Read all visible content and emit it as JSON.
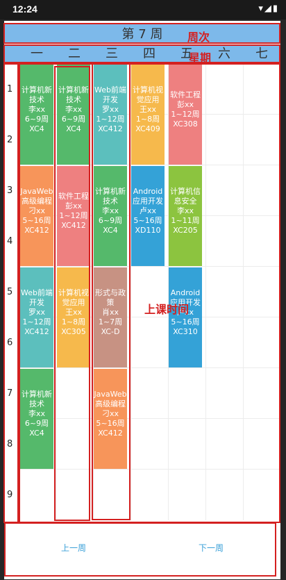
{
  "status": {
    "time": "12:24",
    "icons": "▾◢▮"
  },
  "week_title": "第 7 周",
  "days": [
    "一",
    "二",
    "三",
    "四",
    "五",
    "六",
    "七"
  ],
  "slots": [
    "1",
    "2",
    "3",
    "4",
    "5",
    "6",
    "7",
    "8",
    "9"
  ],
  "annotations": {
    "week": "周次",
    "weekday": "星期",
    "class_time": "上课时间"
  },
  "courses": [
    {
      "lines": [
        "计算机新技术",
        "李xx",
        "6~9周",
        "XC4"
      ]
    },
    {
      "lines": [
        "JavaWeb高级编程",
        "刁xx",
        "5~16周",
        "XC412"
      ]
    },
    {
      "lines": [
        "Web前端开发",
        "罗xx",
        "1~12周",
        "XC412"
      ]
    },
    {
      "lines": [
        "计算机新技术",
        "李xx",
        "6~9周",
        "XC4"
      ]
    },
    {
      "lines": [
        "计算机新技术",
        "李xx",
        "6~9周",
        "XC4"
      ]
    },
    {
      "lines": [
        "软件工程",
        "彭xx",
        "1~12周",
        "XC412"
      ]
    },
    {
      "lines": [
        "计算机视觉应用",
        "王xx",
        "1~8周",
        "XC305"
      ]
    },
    {
      "lines": [
        "Web前端开发",
        "罗xx",
        "1~12周",
        "XC412"
      ]
    },
    {
      "lines": [
        "计算机新技术",
        "李xx",
        "6~9周",
        "XC4"
      ]
    },
    {
      "lines": [
        "形式与政策",
        "肖xx",
        "1~7周",
        "XC-D"
      ]
    },
    {
      "lines": [
        "JavaWeb高级编程",
        "刁xx",
        "5~16周",
        "XC412"
      ]
    },
    {
      "lines": [
        "计算机视觉应用",
        "王xx",
        "1~8周",
        "XC409"
      ]
    },
    {
      "lines": [
        "Android应用开发",
        "卢xx",
        "5~16周",
        "XD110"
      ]
    },
    {
      "lines": [
        "软件工程",
        "彭xx",
        "1~12周",
        "XC308"
      ]
    },
    {
      "lines": [
        "计算机信息安全",
        "李xx",
        "1~11周",
        "XC205"
      ]
    },
    {
      "lines": [
        "Android应用开发",
        "卢xx",
        "5~16周",
        "XC310"
      ]
    }
  ],
  "colors": {
    "green": "#55b96b",
    "orange": "#f7955a",
    "teal": "#5cbfbd",
    "salmon": "#ee8080",
    "yellow": "#f6b94c",
    "brown": "#c79283",
    "blue": "#34a2d7",
    "lime": "#8cc43f",
    "header": "#7db9ea"
  },
  "nav": {
    "prev": "上一周",
    "next": "下一周"
  }
}
